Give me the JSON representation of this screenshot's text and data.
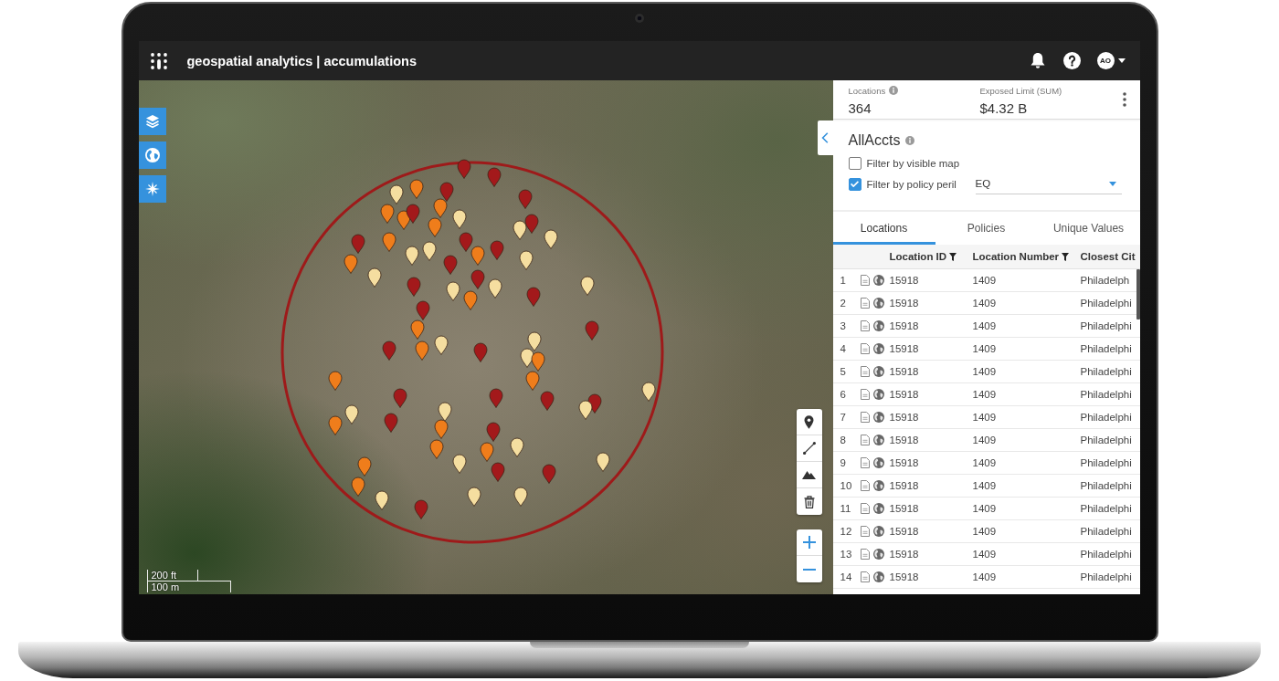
{
  "window": {
    "title": "geospatial analytics | accumulations"
  },
  "header": {
    "avatar": "AO"
  },
  "map": {
    "pins": [
      {
        "color": "#a3191b"
      },
      {
        "color": "#a3191b"
      },
      {
        "color": "#ef7d1b"
      },
      {
        "color": "#f5dea0"
      },
      {
        "color": "#a3191b"
      },
      {
        "color": "#a3191b"
      },
      {
        "color": "#ef7d1b"
      },
      {
        "color": "#ef7d1b"
      },
      {
        "color": "#a3191b"
      },
      {
        "color": "#ef7d1b"
      },
      {
        "color": "#ef7d1b"
      },
      {
        "color": "#f5dea0"
      },
      {
        "color": "#f5dea0"
      },
      {
        "color": "#a3191b"
      },
      {
        "color": "#f5dea0"
      },
      {
        "color": "#a3191b"
      },
      {
        "color": "#ef7d1b"
      },
      {
        "color": "#f5dea0"
      },
      {
        "color": "#f5dea0"
      },
      {
        "color": "#a3191b"
      },
      {
        "color": "#ef7d1b"
      },
      {
        "color": "#a3191b"
      },
      {
        "color": "#f5dea0"
      },
      {
        "color": "#ef7d1b"
      },
      {
        "color": "#f5dea0"
      },
      {
        "color": "#a3191b"
      },
      {
        "color": "#a3191b"
      },
      {
        "color": "#a3191b"
      },
      {
        "color": "#f5dea0"
      },
      {
        "color": "#f5dea0"
      },
      {
        "color": "#ef7d1b"
      },
      {
        "color": "#a3191b"
      },
      {
        "color": "#f5dea0"
      },
      {
        "color": "#a3191b"
      },
      {
        "color": "#ef7d1b"
      },
      {
        "color": "#a3191b"
      },
      {
        "color": "#a3191b"
      },
      {
        "color": "#ef7d1b"
      },
      {
        "color": "#f5dea0"
      },
      {
        "color": "#a3191b"
      },
      {
        "color": "#f5dea0"
      },
      {
        "color": "#f5dea0"
      },
      {
        "color": "#ef7d1b"
      },
      {
        "color": "#ef7d1b"
      },
      {
        "color": "#ef7d1b"
      },
      {
        "color": "#a3191b"
      },
      {
        "color": "#a3191b"
      },
      {
        "color": "#a3191b"
      },
      {
        "color": "#a3191b"
      },
      {
        "color": "#f5dea0"
      },
      {
        "color": "#f5dea0"
      },
      {
        "color": "#f5dea0"
      },
      {
        "color": "#f5dea0"
      },
      {
        "color": "#a3191b"
      },
      {
        "color": "#ef7d1b"
      },
      {
        "color": "#ef7d1b"
      },
      {
        "color": "#a3191b"
      },
      {
        "color": "#f5dea0"
      },
      {
        "color": "#ef7d1b"
      },
      {
        "color": "#ef7d1b"
      },
      {
        "color": "#f5dea0"
      },
      {
        "color": "#f5dea0"
      },
      {
        "color": "#ef7d1b"
      },
      {
        "color": "#a3191b"
      },
      {
        "color": "#a3191b"
      },
      {
        "color": "#ef7d1b"
      },
      {
        "color": "#f5dea0"
      },
      {
        "color": "#f5dea0"
      },
      {
        "color": "#f5dea0"
      },
      {
        "color": "#a3191b"
      }
    ],
    "scale_bar": [
      "200 ft",
      "100 m"
    ]
  },
  "summary": [
    {
      "label": "Locations",
      "value": "364",
      "info": true
    },
    {
      "label": "Exposed Limit (SUM)",
      "value": "$4.32 B",
      "info": false
    }
  ],
  "panel": {
    "title": "AllAccts",
    "filters": [
      {
        "label": "Filter by visible map",
        "checked": false
      },
      {
        "label": "Filter by policy peril",
        "checked": true,
        "dropdown": "EQ"
      }
    ]
  },
  "tabs": [
    {
      "label": "Locations",
      "selected": true
    },
    {
      "label": "Policies",
      "selected": false
    },
    {
      "label": "Unique Values",
      "selected": false
    }
  ],
  "table": {
    "columns": [
      {
        "label": "Location ID",
        "filter": true
      },
      {
        "label": "Location Number",
        "filter": true
      },
      {
        "label": "Closest Cit",
        "filter": false
      }
    ],
    "rows": [
      {
        "number": "1",
        "cells": [
          "15918",
          "1409",
          "Philadelph"
        ]
      },
      {
        "number": "2",
        "cells": [
          "15918",
          "1409",
          "Philadelphi"
        ]
      },
      {
        "number": "3",
        "cells": [
          "15918",
          "1409",
          "Philadelphi"
        ]
      },
      {
        "number": "4",
        "cells": [
          "15918",
          "1409",
          "Philadelphi"
        ]
      },
      {
        "number": "5",
        "cells": [
          "15918",
          "1409",
          "Philadelphi"
        ]
      },
      {
        "number": "6",
        "cells": [
          "15918",
          "1409",
          "Philadelphi"
        ]
      },
      {
        "number": "7",
        "cells": [
          "15918",
          "1409",
          "Philadelphi"
        ]
      },
      {
        "number": "8",
        "cells": [
          "15918",
          "1409",
          "Philadelphi"
        ]
      },
      {
        "number": "9",
        "cells": [
          "15918",
          "1409",
          "Philadelphi"
        ]
      },
      {
        "number": "10",
        "cells": [
          "15918",
          "1409",
          "Philadelphi"
        ]
      },
      {
        "number": "11",
        "cells": [
          "15918",
          "1409",
          "Philadelphi"
        ]
      },
      {
        "number": "12",
        "cells": [
          "15918",
          "1409",
          "Philadelphi"
        ]
      },
      {
        "number": "13",
        "cells": [
          "15918",
          "1409",
          "Philadelphi"
        ]
      },
      {
        "number": "14",
        "cells": [
          "15918",
          "1409",
          "Philadelphi"
        ]
      }
    ]
  }
}
